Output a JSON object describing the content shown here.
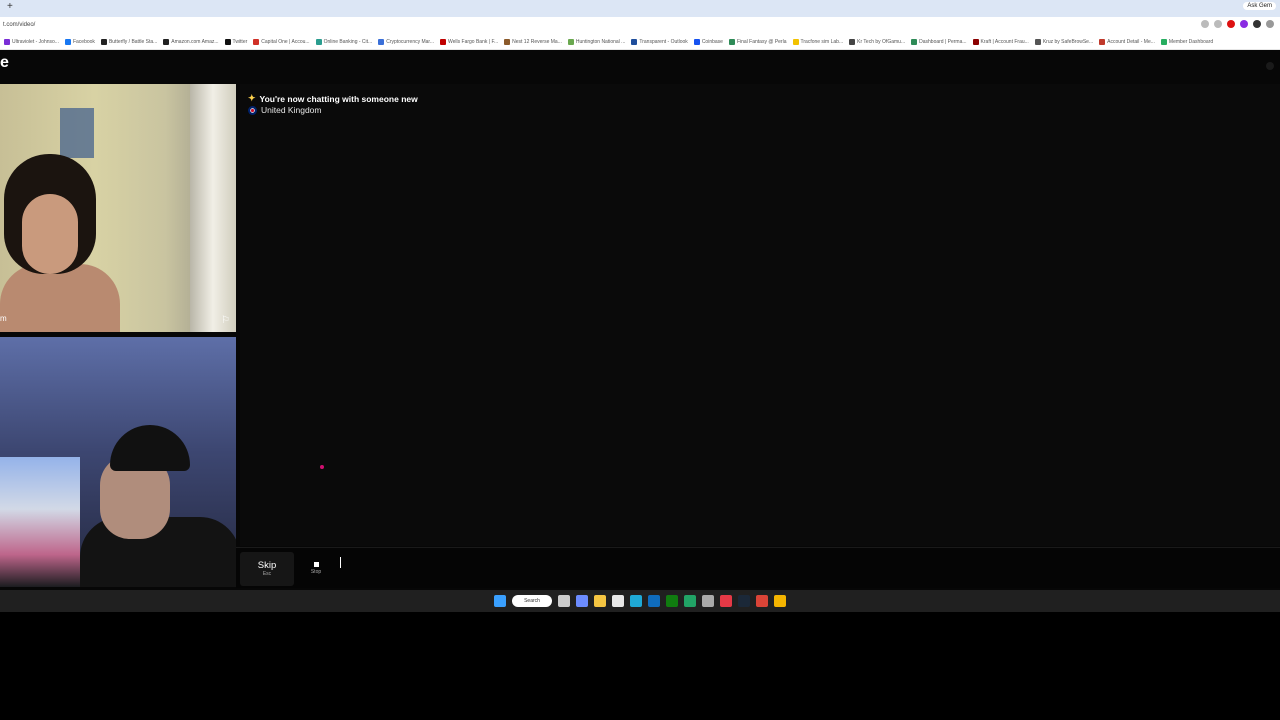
{
  "browser": {
    "newtab_glyph": "+",
    "ask_button": "Ask Gem",
    "url": "t.com/video/",
    "bookmarks": [
      {
        "label": "Ultraviolet - Johnso...",
        "color": "#7a2ed6"
      },
      {
        "label": "Facebook",
        "color": "#1877f2"
      },
      {
        "label": "Butterfly / Battle Sta...",
        "color": "#222222"
      },
      {
        "label": "Amazon.com Amaz...",
        "color": "#222222"
      },
      {
        "label": "Twitter",
        "color": "#111111"
      },
      {
        "label": "Capital One | Accou...",
        "color": "#d03027"
      },
      {
        "label": "Online Banking - Cit...",
        "color": "#2a9d8f"
      },
      {
        "label": "Cryptocurrency Mar...",
        "color": "#3a6fd8"
      },
      {
        "label": "Wells Fargo Bank | F...",
        "color": "#c00000"
      },
      {
        "label": "Nest 12 Reverse Ma...",
        "color": "#8b5a2b"
      },
      {
        "label": "Huntington National ...",
        "color": "#6aa84f"
      },
      {
        "label": "Transparent - Outlook",
        "color": "#1f4e9c"
      },
      {
        "label": "Coinbase",
        "color": "#1652f0"
      },
      {
        "label": "Final Fantasy @ Perla",
        "color": "#2e8b57"
      },
      {
        "label": "Tracfone sim Lab...",
        "color": "#f2c200"
      },
      {
        "label": "Kr Tech by OfGamu...",
        "color": "#444444"
      },
      {
        "label": "Dashboard | Perma...",
        "color": "#2e8b57"
      },
      {
        "label": "Kraft | Account Frau...",
        "color": "#8b0000"
      },
      {
        "label": "Kruz by SafeBrowSe...",
        "color": "#555555"
      },
      {
        "label": "Account Detail - Me...",
        "color": "#c0392b"
      },
      {
        "label": "Member Dashboard",
        "color": "#27ae60"
      }
    ]
  },
  "app": {
    "logo_fragment": "e",
    "stranger_name_fragment": "m",
    "messages": {
      "system": "You're now chatting with someone new",
      "system_icon": "sparkle-icon",
      "location": "United Kingdom",
      "location_icon": "uk-flag-icon"
    },
    "controls": {
      "skip_label": "Skip",
      "skip_hint": "Esc",
      "stop_label": "Stop",
      "input_value": ""
    }
  },
  "taskbar": {
    "search_label": "Search",
    "icons": [
      {
        "name": "start-icon",
        "color": "#3aa0ff"
      },
      {
        "name": "task-view-icon",
        "color": "#cccccc"
      },
      {
        "name": "copilot-icon",
        "color": "#6c8cff"
      },
      {
        "name": "file-explorer-icon",
        "color": "#f5c542"
      },
      {
        "name": "store-icon",
        "color": "#e8e8e8"
      },
      {
        "name": "edge-icon",
        "color": "#1fa9d6"
      },
      {
        "name": "outlook-icon",
        "color": "#0f6cbd"
      },
      {
        "name": "xbox-icon",
        "color": "#107c10"
      },
      {
        "name": "sheets-icon",
        "color": "#21a366"
      },
      {
        "name": "calculator-icon",
        "color": "#aaaaaa"
      },
      {
        "name": "snip-icon",
        "color": "#e63946"
      },
      {
        "name": "steam-icon",
        "color": "#1b2838"
      },
      {
        "name": "chrome-icon",
        "color": "#db4437"
      },
      {
        "name": "chrome-alt-icon",
        "color": "#f4b400"
      }
    ]
  }
}
